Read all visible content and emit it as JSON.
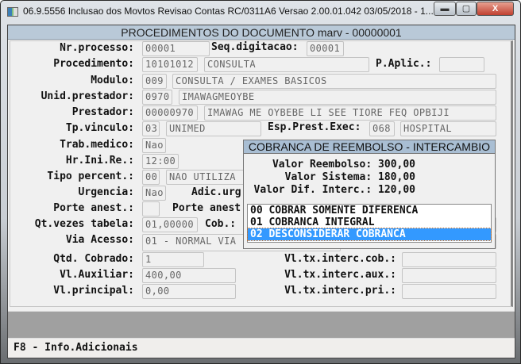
{
  "window": {
    "title": "06.9.5556  Inclusao  dos Movtos Revisao Contas RC/0311A6 Versao 2.00.01.042 03/05/2018 - 1...",
    "minimize": "▬",
    "maximize": "▢",
    "close": "X"
  },
  "header": {
    "title": "PROCEDIMENTOS DO DOCUMENTO marv - 00000001"
  },
  "form": {
    "nr_processo": {
      "label": "Nr.processo:",
      "value": "00001"
    },
    "seq_digitacao": {
      "label": "Seq.digitacao:",
      "value": "00001"
    },
    "procedimento": {
      "label": "Procedimento:",
      "code": "10101012",
      "desc": "CONSULTA"
    },
    "p_aplic": {
      "label": "P.Aplic.:",
      "value": ""
    },
    "modulo": {
      "label": "Modulo:",
      "code": "009",
      "desc": "CONSULTA / EXAMES BASICOS"
    },
    "unid_prestador": {
      "label": "Unid.prestador:",
      "code": "0970",
      "desc": "IMAWAGMEOYBE"
    },
    "prestador": {
      "label": "Prestador:",
      "code": "00000970",
      "desc": "IMAWAG ME OYBEBE LI SEE TIORE FEQ OPBIJI"
    },
    "tp_vinculo": {
      "label": "Tp.vinculo:",
      "code": "03",
      "desc": "UNIMED"
    },
    "esp_prest_exec": {
      "label": "Esp.Prest.Exec:",
      "code": "068",
      "desc": "HOSPITAL"
    },
    "trab_medico": {
      "label": "Trab.medico:",
      "value": "Nao"
    },
    "hr_ini_re": {
      "label": "Hr.Ini.Re.:",
      "value": "12:00"
    },
    "tipo_percent": {
      "label": "Tipo percent.:",
      "code": "00",
      "desc": "NAO UTILIZA"
    },
    "urgencia": {
      "label": "Urgencia:",
      "value": "Nao"
    },
    "adic_urg": {
      "label": "Adic.urg"
    },
    "porte_anest": {
      "label": "Porte anest.:",
      "value": ""
    },
    "porte_anest2": {
      "label": "Porte anest"
    },
    "qt_vezes_tabela": {
      "label": "Qt.vezes tabela:",
      "value": "01,00000"
    },
    "cob": {
      "label": "Cob.:"
    },
    "via_acesso": {
      "label": "Via Acesso:",
      "value": "01 - NORMAL VIA"
    },
    "qtd_cobrado": {
      "label": "Qtd. Cobrado:",
      "value": "1"
    },
    "vl_auxiliar": {
      "label": "Vl.Auxiliar:",
      "value": "400,00"
    },
    "vl_principal": {
      "label": "Vl.principal:",
      "value": "0,00"
    },
    "vl_tx_interc_cob": {
      "label": "Vl.tx.interc.cob.:",
      "value": ""
    },
    "vl_tx_interc_aux": {
      "label": "Vl.tx.interc.aux.:",
      "value": ""
    },
    "vl_tx_interc_pri": {
      "label": "Vl.tx.interc.pri.:",
      "value": ""
    }
  },
  "popup": {
    "title": "COBRANCA DE REEMBOLSO - INTERCAMBIO",
    "lines": [
      "Valor Reembolso: 300,00",
      "Valor Sistema: 180,00",
      "Valor Dif. Interc.: 120,00"
    ],
    "options": [
      "00 COBRAR SOMENTE DIFERENCA",
      "01 COBRANCA INTEGRAL",
      "02 DESCONSIDERAR COBRANCA"
    ],
    "selected_index": 2,
    "selected_color": "#3399ff"
  },
  "status": {
    "text": "F8 - Info.Adicionais"
  }
}
